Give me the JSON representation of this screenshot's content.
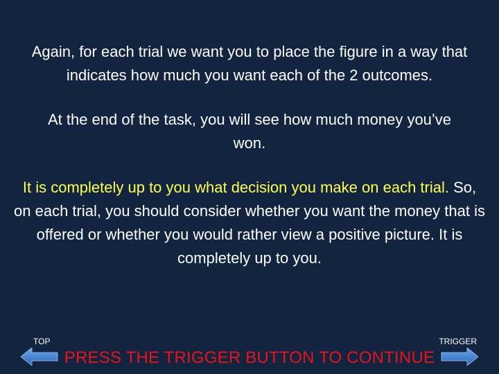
{
  "instructions": {
    "para1": "Again, for each trial we want you to place the figure in a way that indicates how much you want each of the 2 outcomes.",
    "para2": "At the end of the task, you will see how much money you’ve won.",
    "para3_highlight": "It is completely up to you what decision you make on each trial.",
    "para3_rest": " So, on each trial, you should consider whether you want the money that is offered or whether you would rather view a positive picture. It is completely up to you."
  },
  "navigation": {
    "left_label": "TOP",
    "right_label": "TRIGGER",
    "continue_prompt": "PRESS THE TRIGGER BUTTON TO CONTINUE",
    "left_icon": "arrow-left-icon",
    "right_icon": "arrow-right-icon"
  },
  "colors": {
    "background": "#12243f",
    "text": "#ffffff",
    "highlight": "#ffff4d",
    "prompt": "#e8141c",
    "arrow": "#3f7fd1"
  }
}
